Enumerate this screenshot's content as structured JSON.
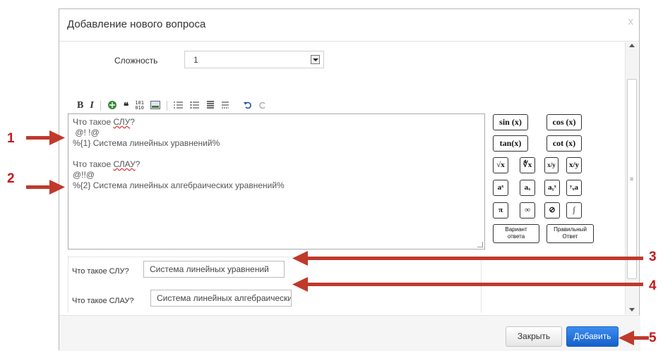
{
  "dialog": {
    "title": "Добавление нового вопроса",
    "close_glyph": "x"
  },
  "difficulty": {
    "label": "Сложность",
    "value": "1"
  },
  "toolbar": {
    "bold": "B",
    "italic": "I",
    "quote": "❝",
    "code": "101",
    "icons": [
      "bold-icon",
      "italic-icon",
      "link-icon",
      "blockquote-icon",
      "code-icon",
      "image-icon",
      "ordered-list-icon",
      "unordered-list-icon",
      "heading-icon",
      "horizontal-rule-icon",
      "undo-icon",
      "redo-icon"
    ]
  },
  "editor": {
    "lines": [
      {
        "pre": "Что такое ",
        "u": "СЛУ",
        "post": "?"
      },
      {
        "pre": " @! !@",
        "u": "",
        "post": ""
      },
      {
        "pre": "%{1} Система линейных уравнений%",
        "u": "",
        "post": ""
      },
      {
        "pre": "",
        "u": "",
        "post": ""
      },
      {
        "pre": "Что такое ",
        "u": "СЛАУ",
        "post": "?"
      },
      {
        "pre": "@!!@",
        "u": "",
        "post": ""
      },
      {
        "pre": "%{2} Система линейных алгебраических уравнений%",
        "u": "",
        "post": ""
      }
    ]
  },
  "math_buttons": {
    "sin": "sin (x)",
    "cos": "cos (x)",
    "tan": "tan(x)",
    "cot": "cot (x)",
    "sqrt": "√x",
    "nthroot": "∜x",
    "frac": "x/y",
    "slash": "x/y",
    "pow": "aˣ",
    "sub": "aₓ",
    "subsup": "aᵧˣ",
    "presub": "ʸₓa",
    "pi": "π",
    "infinity": "∞",
    "empty": "⊘",
    "integral": "∫",
    "variant_line1": "Вариант",
    "variant_line2": "ответа",
    "correct_line1": "Правильный",
    "correct_line2": "Ответ"
  },
  "answers": [
    {
      "label": "Что такое СЛУ?",
      "value": "Система линейных уравнений"
    },
    {
      "label": "Что такое СЛАУ?",
      "value": "Система линейных алгебраических уравнений"
    }
  ],
  "footer": {
    "close_label": "Закрыть",
    "add_label": "Добавить"
  },
  "annotations": {
    "n1": "1",
    "n2": "2",
    "n3": "3",
    "n4": "4",
    "n5": "5",
    "color": "#c0392b"
  }
}
